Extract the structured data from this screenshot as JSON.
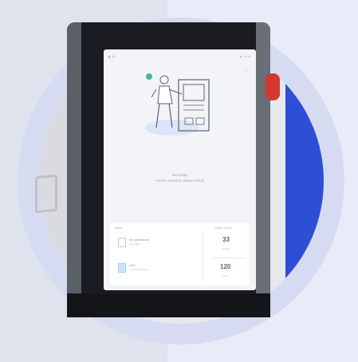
{
  "status_bar": {
    "left": "◣ 16",
    "right": "▲ 12:41"
  },
  "menu_label": "⋮",
  "illustration": {
    "name": "operator-at-machine"
  },
  "message": {
    "line1": "Not ready",
    "line2": "service required, please check"
  },
  "stats_card": {
    "left_header": "Status",
    "right_header": "Today's orders",
    "row1": {
      "text": "No operations",
      "sub": "scheduled"
    },
    "row2": {
      "text": "46%",
      "sub": "Available capacity"
    },
    "stat1": {
      "value": "33",
      "label": "Orders"
    },
    "stat2": {
      "value": "120",
      "label": "Items"
    }
  },
  "colors": {
    "accent_blue": "#2d4fd6",
    "estop_red": "#d23a2f"
  }
}
